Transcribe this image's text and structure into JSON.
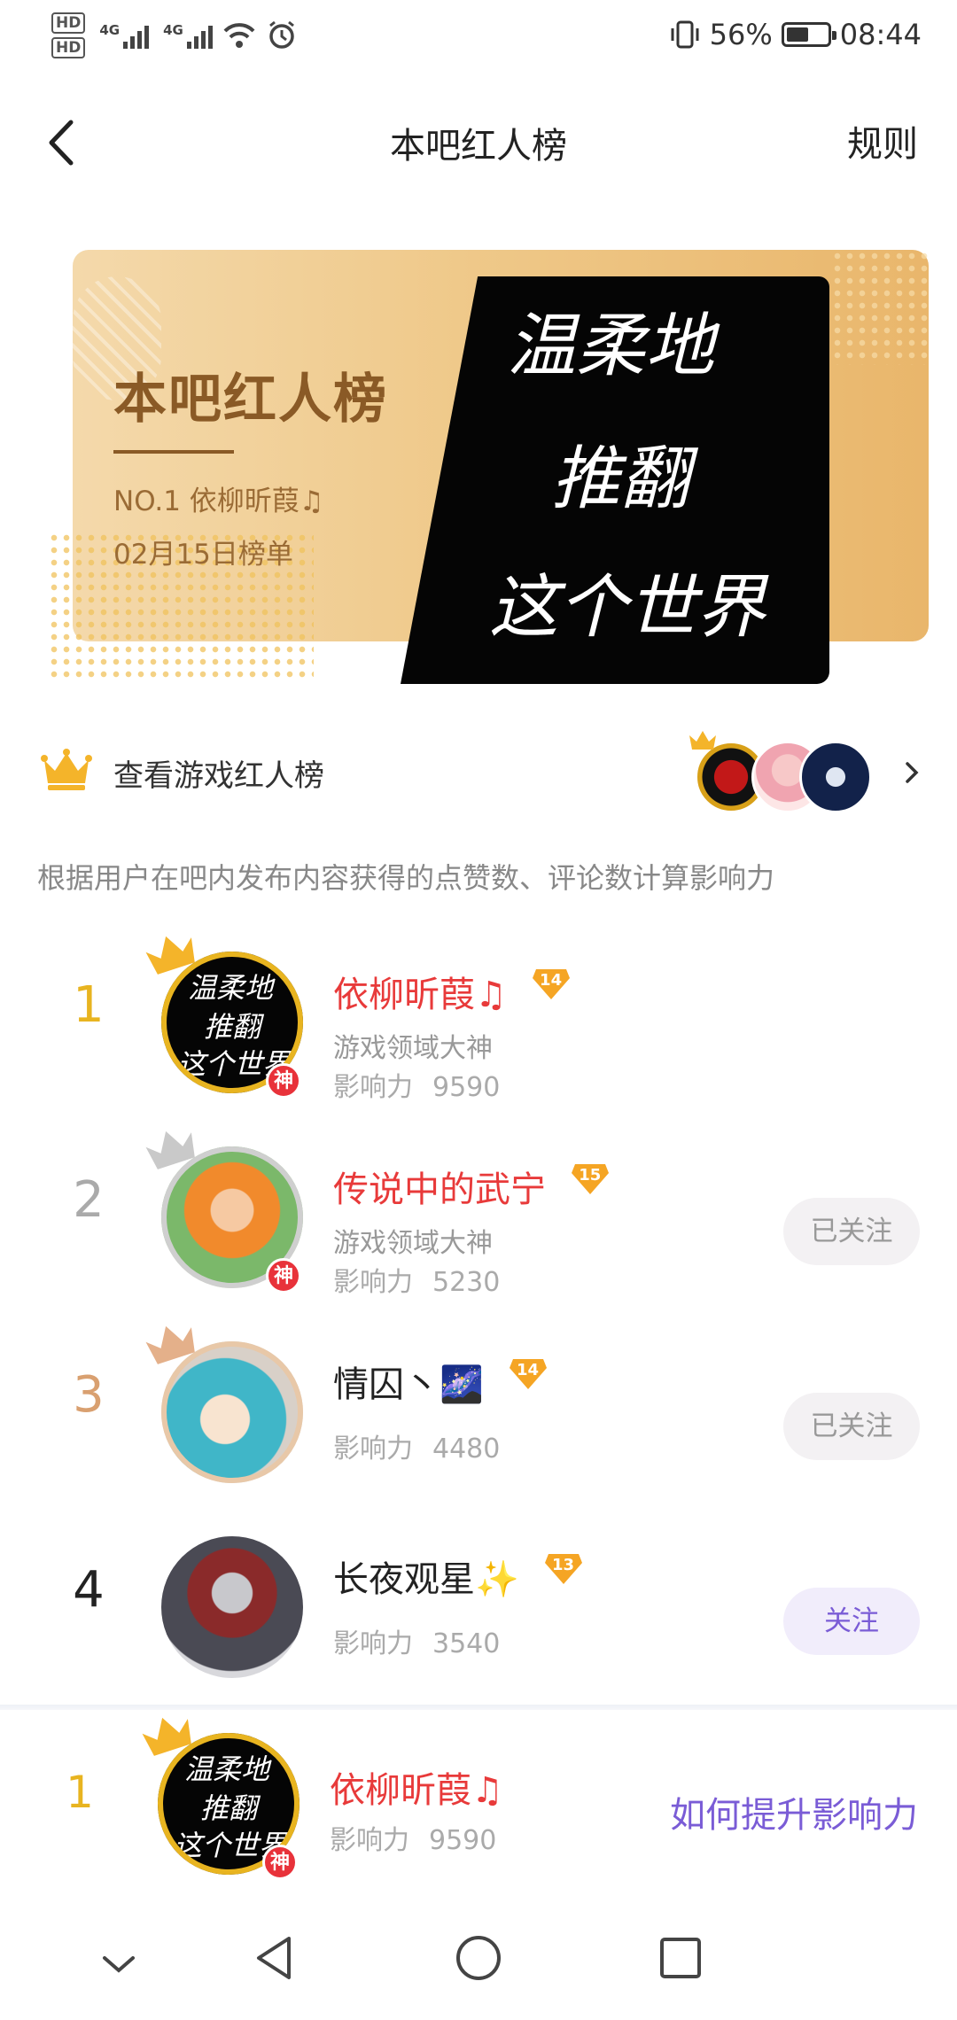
{
  "status_bar": {
    "hd1": "HD",
    "hd2": "HD",
    "net1": "4G",
    "net2": "4G",
    "battery_percent": "56%",
    "time": "08:44"
  },
  "header": {
    "title": "本吧红人榜",
    "rules_label": "规则",
    "back_icon": "chevron-left-icon"
  },
  "banner": {
    "title": "本吧红人榜",
    "top_user": "NO.1  依柳昕葭♫",
    "date": "02月15日榜单",
    "art_text": [
      "温柔地",
      "推翻",
      "这个世界"
    ]
  },
  "game_row": {
    "label": "查看游戏红人榜",
    "icon": "crown-icon"
  },
  "description": "根据用户在吧内发布内容获得的点赞数、评论数计算影响力",
  "ranking": [
    {
      "rank": "1",
      "name": "依柳昕葭♫",
      "level": "14",
      "title": "游戏领域大神",
      "influence_label": "影响力",
      "influence": "9590",
      "badge": "神",
      "button": ""
    },
    {
      "rank": "2",
      "name": "传说中的武宁",
      "level": "15",
      "title": "游戏领域大神",
      "influence_label": "影响力",
      "influence": "5230",
      "badge": "神",
      "button": "已关注"
    },
    {
      "rank": "3",
      "name": "情囚丶🌌",
      "level": "14",
      "title": "",
      "influence_label": "影响力",
      "influence": "4480",
      "badge": "",
      "button": "已关注"
    },
    {
      "rank": "4",
      "name": "长夜观星✨",
      "level": "13",
      "title": "",
      "influence_label": "影响力",
      "influence": "3540",
      "badge": "",
      "button": "关注"
    }
  ],
  "my_rank": {
    "rank": "1",
    "name": "依柳昕葭♫",
    "influence_label": "影响力",
    "influence": "9590",
    "badge": "神",
    "how_label": "如何提升影响力"
  },
  "colors": {
    "accent_red": "#e83a3a",
    "gold": "#e8b420",
    "purple": "#7a5cd6",
    "banner_brown": "#8a5a26"
  }
}
